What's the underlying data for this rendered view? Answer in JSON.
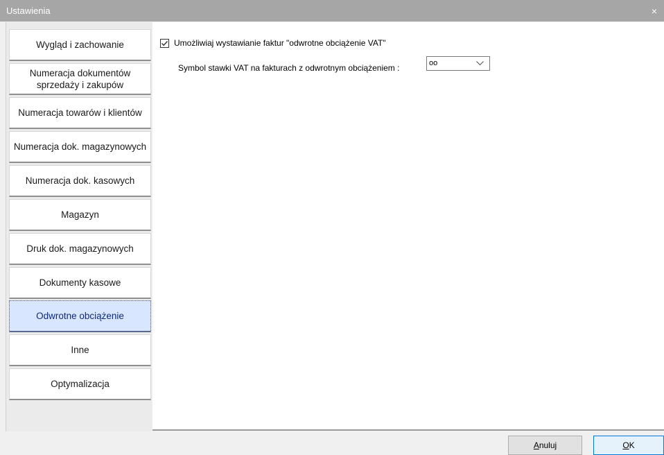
{
  "window": {
    "title": "Ustawienia",
    "close_glyph": "×"
  },
  "sidebar": {
    "items": [
      {
        "label": "Wygląd i zachowanie",
        "active": false
      },
      {
        "label": "Numeracja dokumentów sprzedaży i zakupów",
        "active": false
      },
      {
        "label": "Numeracja towarów i klientów",
        "active": false
      },
      {
        "label": "Numeracja dok. magazynowych",
        "active": false
      },
      {
        "label": "Numeracja dok. kasowych",
        "active": false
      },
      {
        "label": "Magazyn",
        "active": false
      },
      {
        "label": "Druk dok. magazynowych",
        "active": false
      },
      {
        "label": "Dokumenty kasowe",
        "active": false
      },
      {
        "label": "Odwrotne obciążenie",
        "active": true
      },
      {
        "label": "Inne",
        "active": false
      },
      {
        "label": "Optymalizacja",
        "active": false
      }
    ]
  },
  "settings": {
    "reverse_charge_checkbox": {
      "label": "Umożliwiaj wystawianie faktur \"odwrotne obciążenie VAT\"",
      "checked": true
    },
    "vat_symbol": {
      "label": "Symbol stawki VAT na fakturach z odwrotnym obciążeniem :",
      "value": "oo"
    }
  },
  "footer": {
    "cancel_first": "A",
    "cancel_rest": "nuluj",
    "ok_first": "O",
    "ok_rest": "K"
  },
  "colors": {
    "titlebar": "#a6a6a6",
    "active_item_bg": "#d9e6ff",
    "active_item_text": "#0f2a78"
  },
  "icons": {
    "close": "close-icon",
    "checkbox": "checkmark-icon",
    "dropdown": "chevron-down-icon"
  }
}
